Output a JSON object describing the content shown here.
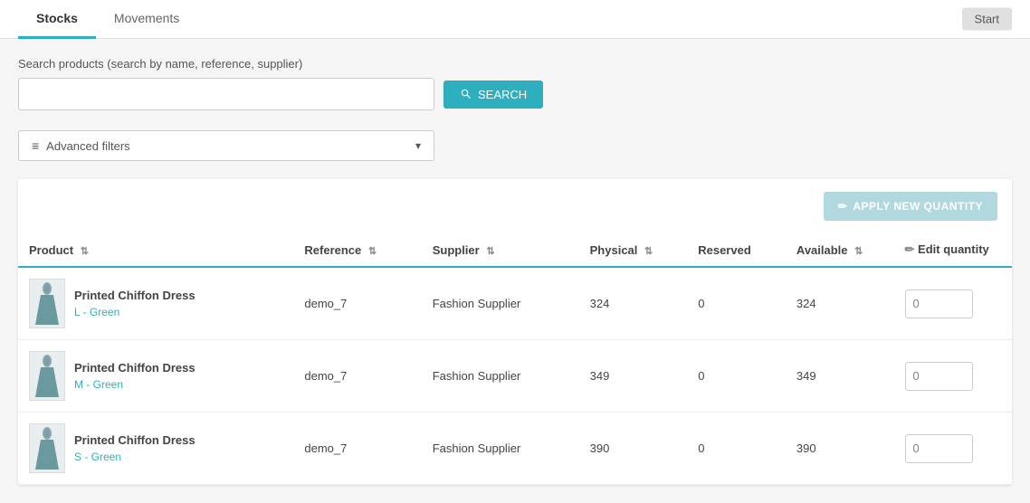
{
  "tabs": [
    {
      "label": "Stocks",
      "active": true
    },
    {
      "label": "Movements",
      "active": false
    }
  ],
  "start_button": "Start",
  "search": {
    "label": "Search products (search by name, reference, supplier)",
    "placeholder": "",
    "button_label": "SEARCH"
  },
  "filters": {
    "label": "Advanced filters",
    "icon": "≡"
  },
  "table": {
    "apply_button": "APPLY NEW QUANTITY",
    "columns": {
      "product": "Product",
      "reference": "Reference",
      "supplier": "Supplier",
      "physical": "Physical",
      "reserved": "Reserved",
      "available": "Available",
      "edit": "Edit quantity"
    },
    "rows": [
      {
        "product_name": "Printed Chiffon Dress",
        "variant": "L - Green",
        "reference": "demo_7",
        "supplier": "Fashion Supplier",
        "physical": "324",
        "reserved": "0",
        "available": "324",
        "edit_value": "0"
      },
      {
        "product_name": "Printed Chiffon Dress",
        "variant": "M - Green",
        "reference": "demo_7",
        "supplier": "Fashion Supplier",
        "physical": "349",
        "reserved": "0",
        "available": "349",
        "edit_value": "0"
      },
      {
        "product_name": "Printed Chiffon Dress",
        "variant": "S - Green",
        "reference": "demo_7",
        "supplier": "Fashion Supplier",
        "physical": "390",
        "reserved": "0",
        "available": "390",
        "edit_value": "0"
      }
    ]
  },
  "colors": {
    "accent": "#2eafc0",
    "apply_btn": "#b0d8de"
  }
}
